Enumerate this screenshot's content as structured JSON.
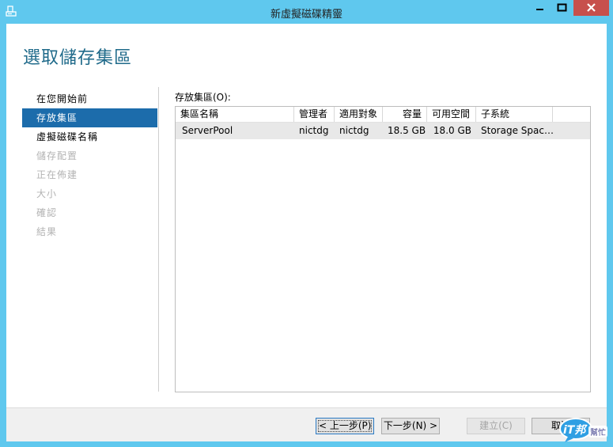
{
  "window": {
    "title": "新虛擬磁碟精靈",
    "icon": "wizard-app-icon"
  },
  "heading": "選取儲存集區",
  "nav": {
    "items": [
      {
        "label": "在您開始前",
        "state": "normal"
      },
      {
        "label": "存放集區",
        "state": "active"
      },
      {
        "label": "虛擬磁碟名稱",
        "state": "normal"
      },
      {
        "label": "儲存配置",
        "state": "disabled"
      },
      {
        "label": "正在佈建",
        "state": "disabled"
      },
      {
        "label": "大小",
        "state": "disabled"
      },
      {
        "label": "確認",
        "state": "disabled"
      },
      {
        "label": "結果",
        "state": "disabled"
      }
    ]
  },
  "pool_list": {
    "caption": "存放集區(O):",
    "columns": [
      "集區名稱",
      "管理者",
      "適用對象",
      "容量",
      "可用空間",
      "子系統"
    ],
    "rows": [
      [
        "ServerPool",
        "nictdg",
        "nictdg",
        "18.5 GB",
        "18.0 GB",
        "Storage Spac…"
      ]
    ]
  },
  "footer": {
    "prev": "< 上一步(P)",
    "next": "下一步(N) >",
    "create": "建立(C)",
    "cancel": "取消"
  },
  "watermark": {
    "text": "iT邦幫忙"
  },
  "colors": {
    "titlebar": "#5fc8ee",
    "accent": "#1c6cab",
    "close": "#c7504c",
    "heading": "#1f6a8a"
  }
}
